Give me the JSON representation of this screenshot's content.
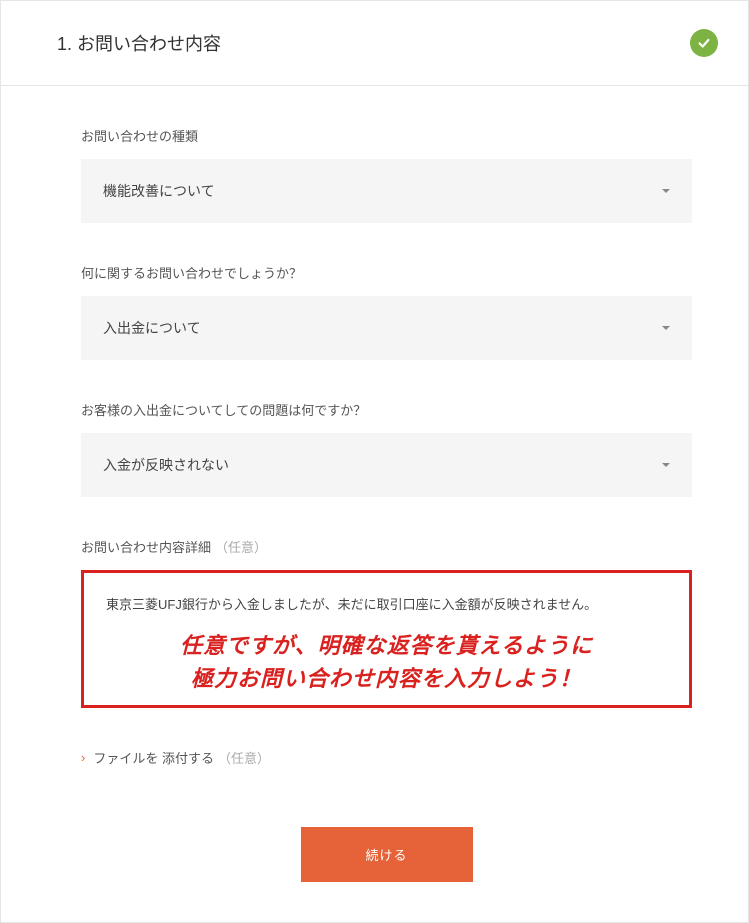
{
  "header": {
    "title": "1. お問い合わせ内容"
  },
  "fields": {
    "type": {
      "label": "お問い合わせの種類",
      "value": "機能改善について"
    },
    "topic": {
      "label": "何に関するお問い合わせでしょうか？",
      "value": "入出金について"
    },
    "issue": {
      "label": "お客様の入出金についてしての問題は何ですか？",
      "value": "入金が反映されない"
    },
    "details": {
      "label": "お問い合わせ内容詳細",
      "optional": "（任意）",
      "value": "東京三菱UFJ銀行から入金しましたが、未だに取引口座に入金額が反映されません。",
      "overlay_line1": "任意ですが、明確な返答を貰えるように",
      "overlay_line2": "極力お問い合わせ内容を入力しよう！"
    },
    "attach": {
      "label": "ファイルを 添付する",
      "optional": "（任意）"
    }
  },
  "submit": {
    "label": "続ける"
  }
}
